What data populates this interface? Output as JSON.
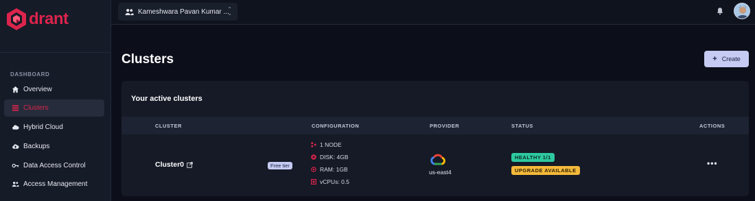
{
  "brand": {
    "name": "drant",
    "color": "#dc244c"
  },
  "sidebar": {
    "section": "DASHBOARD",
    "items": [
      {
        "label": "Overview",
        "icon": "home-icon",
        "active": false
      },
      {
        "label": "Clusters",
        "icon": "list-icon",
        "active": true
      },
      {
        "label": "Hybrid Cloud",
        "icon": "cloud-icon",
        "active": false
      },
      {
        "label": "Backups",
        "icon": "cloud-upload-icon",
        "active": false
      },
      {
        "label": "Data Access Control",
        "icon": "key-icon",
        "active": false
      },
      {
        "label": "Access Management",
        "icon": "people-icon",
        "active": false
      }
    ]
  },
  "topbar": {
    "account": "Kameshwara Pavan Kumar ...",
    "account_icon": "people-icon",
    "notifications_icon": "bell-icon"
  },
  "page": {
    "title": "Clusters",
    "create_label": "Create"
  },
  "card": {
    "title": "Your active clusters",
    "columns": [
      "CLUSTER",
      "CONFIGURATION",
      "PROVIDER",
      "STATUS",
      "ACTIONS"
    ],
    "rows": [
      {
        "name": "Cluster0",
        "tier": "Free tier",
        "config": {
          "nodes": "1 NODE",
          "disk": "DISK: 4GB",
          "ram": "RAM: 1GB",
          "vcpus": "vCPUs: 0.5"
        },
        "provider_icon": "google-cloud-icon",
        "region": "us-east4",
        "status_health": "HEALTHY 1/1",
        "status_upgrade": "UPGRADE AVAILABLE",
        "actions": "•••"
      }
    ]
  },
  "colors": {
    "accent": "#dc244c",
    "button": "#c5cbf2",
    "healthy": "#2ec8a0",
    "upgrade": "#f4b93a"
  }
}
